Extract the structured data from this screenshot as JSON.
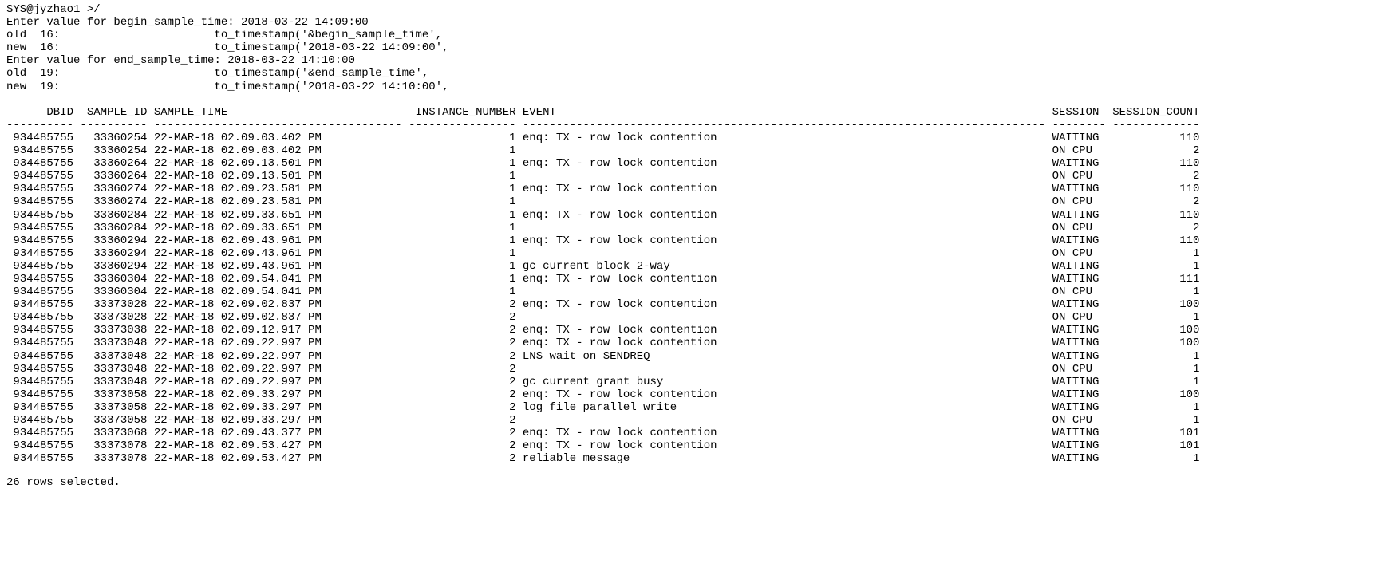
{
  "prompt_lines": [
    "SYS@jyzhao1 >/",
    "Enter value for begin_sample_time: 2018-03-22 14:09:00",
    "old  16:                       to_timestamp('&begin_sample_time',",
    "new  16:                       to_timestamp('2018-03-22 14:09:00',",
    "Enter value for end_sample_time: 2018-03-22 14:10:00",
    "old  19:                       to_timestamp('&end_sample_time',",
    "new  19:                       to_timestamp('2018-03-22 14:10:00',",
    ""
  ],
  "columns": [
    "DBID",
    "SAMPLE_ID",
    "SAMPLE_TIME",
    "INSTANCE_NUMBER",
    "EVENT",
    "SESSION",
    "SESSION_COUNT"
  ],
  "rows": [
    {
      "dbid": "934485755",
      "sample_id": "33360254",
      "sample_time": "22-MAR-18 02.09.03.402 PM",
      "instance": "1",
      "event": "enq: TX - row lock contention",
      "session": "WAITING",
      "count": "110"
    },
    {
      "dbid": "934485755",
      "sample_id": "33360254",
      "sample_time": "22-MAR-18 02.09.03.402 PM",
      "instance": "1",
      "event": "",
      "session": "ON CPU",
      "count": "2"
    },
    {
      "dbid": "934485755",
      "sample_id": "33360264",
      "sample_time": "22-MAR-18 02.09.13.501 PM",
      "instance": "1",
      "event": "enq: TX - row lock contention",
      "session": "WAITING",
      "count": "110"
    },
    {
      "dbid": "934485755",
      "sample_id": "33360264",
      "sample_time": "22-MAR-18 02.09.13.501 PM",
      "instance": "1",
      "event": "",
      "session": "ON CPU",
      "count": "2"
    },
    {
      "dbid": "934485755",
      "sample_id": "33360274",
      "sample_time": "22-MAR-18 02.09.23.581 PM",
      "instance": "1",
      "event": "enq: TX - row lock contention",
      "session": "WAITING",
      "count": "110"
    },
    {
      "dbid": "934485755",
      "sample_id": "33360274",
      "sample_time": "22-MAR-18 02.09.23.581 PM",
      "instance": "1",
      "event": "",
      "session": "ON CPU",
      "count": "2"
    },
    {
      "dbid": "934485755",
      "sample_id": "33360284",
      "sample_time": "22-MAR-18 02.09.33.651 PM",
      "instance": "1",
      "event": "enq: TX - row lock contention",
      "session": "WAITING",
      "count": "110"
    },
    {
      "dbid": "934485755",
      "sample_id": "33360284",
      "sample_time": "22-MAR-18 02.09.33.651 PM",
      "instance": "1",
      "event": "",
      "session": "ON CPU",
      "count": "2"
    },
    {
      "dbid": "934485755",
      "sample_id": "33360294",
      "sample_time": "22-MAR-18 02.09.43.961 PM",
      "instance": "1",
      "event": "enq: TX - row lock contention",
      "session": "WAITING",
      "count": "110"
    },
    {
      "dbid": "934485755",
      "sample_id": "33360294",
      "sample_time": "22-MAR-18 02.09.43.961 PM",
      "instance": "1",
      "event": "",
      "session": "ON CPU",
      "count": "1"
    },
    {
      "dbid": "934485755",
      "sample_id": "33360294",
      "sample_time": "22-MAR-18 02.09.43.961 PM",
      "instance": "1",
      "event": "gc current block 2-way",
      "session": "WAITING",
      "count": "1"
    },
    {
      "dbid": "934485755",
      "sample_id": "33360304",
      "sample_time": "22-MAR-18 02.09.54.041 PM",
      "instance": "1",
      "event": "enq: TX - row lock contention",
      "session": "WAITING",
      "count": "111"
    },
    {
      "dbid": "934485755",
      "sample_id": "33360304",
      "sample_time": "22-MAR-18 02.09.54.041 PM",
      "instance": "1",
      "event": "",
      "session": "ON CPU",
      "count": "1"
    },
    {
      "dbid": "934485755",
      "sample_id": "33373028",
      "sample_time": "22-MAR-18 02.09.02.837 PM",
      "instance": "2",
      "event": "enq: TX - row lock contention",
      "session": "WAITING",
      "count": "100"
    },
    {
      "dbid": "934485755",
      "sample_id": "33373028",
      "sample_time": "22-MAR-18 02.09.02.837 PM",
      "instance": "2",
      "event": "",
      "session": "ON CPU",
      "count": "1"
    },
    {
      "dbid": "934485755",
      "sample_id": "33373038",
      "sample_time": "22-MAR-18 02.09.12.917 PM",
      "instance": "2",
      "event": "enq: TX - row lock contention",
      "session": "WAITING",
      "count": "100"
    },
    {
      "dbid": "934485755",
      "sample_id": "33373048",
      "sample_time": "22-MAR-18 02.09.22.997 PM",
      "instance": "2",
      "event": "enq: TX - row lock contention",
      "session": "WAITING",
      "count": "100"
    },
    {
      "dbid": "934485755",
      "sample_id": "33373048",
      "sample_time": "22-MAR-18 02.09.22.997 PM",
      "instance": "2",
      "event": "LNS wait on SENDREQ",
      "session": "WAITING",
      "count": "1"
    },
    {
      "dbid": "934485755",
      "sample_id": "33373048",
      "sample_time": "22-MAR-18 02.09.22.997 PM",
      "instance": "2",
      "event": "",
      "session": "ON CPU",
      "count": "1"
    },
    {
      "dbid": "934485755",
      "sample_id": "33373048",
      "sample_time": "22-MAR-18 02.09.22.997 PM",
      "instance": "2",
      "event": "gc current grant busy",
      "session": "WAITING",
      "count": "1"
    },
    {
      "dbid": "934485755",
      "sample_id": "33373058",
      "sample_time": "22-MAR-18 02.09.33.297 PM",
      "instance": "2",
      "event": "enq: TX - row lock contention",
      "session": "WAITING",
      "count": "100"
    },
    {
      "dbid": "934485755",
      "sample_id": "33373058",
      "sample_time": "22-MAR-18 02.09.33.297 PM",
      "instance": "2",
      "event": "log file parallel write",
      "session": "WAITING",
      "count": "1"
    },
    {
      "dbid": "934485755",
      "sample_id": "33373058",
      "sample_time": "22-MAR-18 02.09.33.297 PM",
      "instance": "2",
      "event": "",
      "session": "ON CPU",
      "count": "1"
    },
    {
      "dbid": "934485755",
      "sample_id": "33373068",
      "sample_time": "22-MAR-18 02.09.43.377 PM",
      "instance": "2",
      "event": "enq: TX - row lock contention",
      "session": "WAITING",
      "count": "101"
    },
    {
      "dbid": "934485755",
      "sample_id": "33373078",
      "sample_time": "22-MAR-18 02.09.53.427 PM",
      "instance": "2",
      "event": "enq: TX - row lock contention",
      "session": "WAITING",
      "count": "101"
    },
    {
      "dbid": "934485755",
      "sample_id": "33373078",
      "sample_time": "22-MAR-18 02.09.53.427 PM",
      "instance": "2",
      "event": "reliable message",
      "session": "WAITING",
      "count": "1"
    }
  ],
  "footer": "26 rows selected.",
  "widths": {
    "dbid": 10,
    "sample_id": 10,
    "sample_time": 37,
    "instance": 16,
    "event": 78,
    "session": 8,
    "count": 13
  }
}
